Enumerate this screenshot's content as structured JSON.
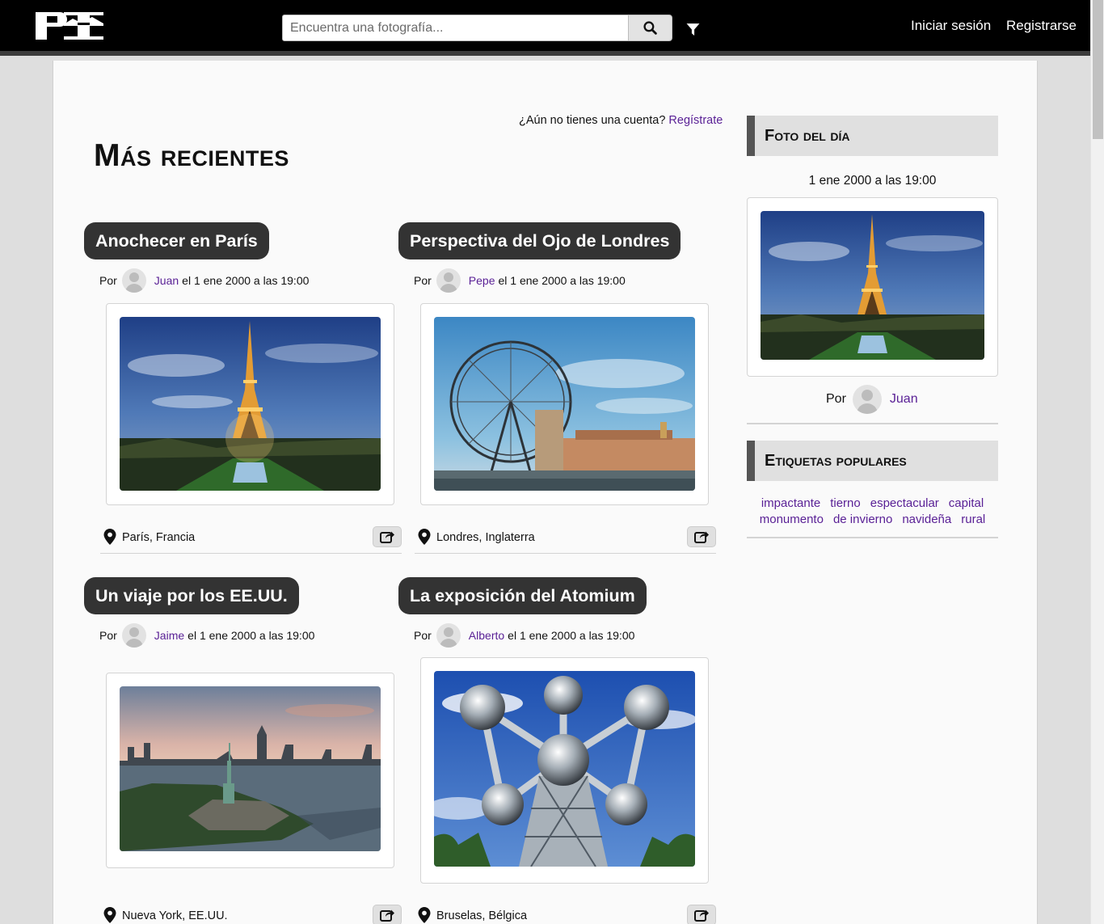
{
  "header": {
    "search_placeholder": "Encuentra una fotografía...",
    "login_label": "Iniciar sesión",
    "register_label": "Registrarse",
    "icons": [
      "search-icon",
      "filter-icon"
    ]
  },
  "main": {
    "signup_prompt": "¿Aún no tienes una cuenta?",
    "signup_link": "Regístrate",
    "title": "Más recientes",
    "por_label": "Por",
    "posts": [
      {
        "title": "Anochecer en París",
        "author": "Juan",
        "date": "el 1 ene 2000 a las 19:00",
        "location": "París, Francia",
        "photo": "eiffel-tower-night"
      },
      {
        "title": "Perspectiva del Ojo de Londres",
        "author": "Pepe",
        "date": "el 1 ene 2000 a las 19:00",
        "location": "Londres, Inglaterra",
        "photo": "london-eye"
      },
      {
        "title": "Un viaje por los EE.UU.",
        "author": "Jaime",
        "date": "el 1 ene 2000 a las 19:00",
        "location": "Nueva York, EE.UU.",
        "photo": "statue-of-liberty"
      },
      {
        "title": "La exposición del Atomium",
        "author": "Alberto",
        "date": "el 1 ene 2000 a las 19:00",
        "location": "Bruselas, Bélgica",
        "photo": "atomium"
      }
    ]
  },
  "sidebar": {
    "photo_of_day_title": "Foto del día",
    "photo_of_day_date": "1 ene 2000 a las 19:00",
    "photo_of_day_author": "Juan",
    "popular_tags_title": "Etiquetas populares",
    "tags": [
      "impactante",
      "tierno",
      "espectacular",
      "capital",
      "monumento",
      "de invierno",
      "navideña",
      "rural"
    ]
  },
  "colors": {
    "accent_link": "#5a2196",
    "header_bg": "#000000",
    "title_pill": "#333333"
  }
}
